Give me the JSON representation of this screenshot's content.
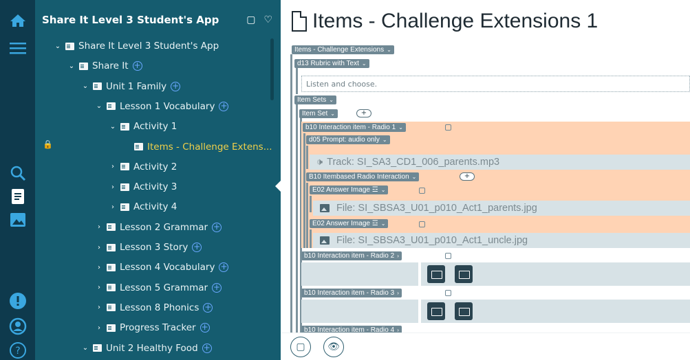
{
  "app": {
    "title": "Share It Level 3 Student's App",
    "header_icons": [
      "copy-icon",
      "heart-icon"
    ],
    "rail_icons": [
      "home-icon",
      "menu-icon",
      "search-icon",
      "document-icon",
      "image-icon",
      "alert-icon",
      "user-icon",
      "help-icon"
    ]
  },
  "tree": {
    "nodes": [
      {
        "label": "Share It Level 3 Student's App",
        "level": 1,
        "expanded": true,
        "add": false
      },
      {
        "label": "Share It",
        "level": 2,
        "expanded": true,
        "add": true
      },
      {
        "label": "Unit 1 Family",
        "level": 3,
        "expanded": true,
        "add": true
      },
      {
        "label": "Lesson 1 Vocabulary",
        "level": 4,
        "expanded": true,
        "add": true
      },
      {
        "label": "Activity 1",
        "level": 5,
        "expanded": true,
        "add": false
      },
      {
        "label": "Items - Challenge Extens...",
        "level": 6,
        "expanded": null,
        "add": false,
        "active": true
      },
      {
        "label": "Activity 2",
        "level": 5,
        "expanded": false,
        "add": false
      },
      {
        "label": "Activity 3",
        "level": 5,
        "expanded": false,
        "add": false
      },
      {
        "label": "Activity 4",
        "level": 5,
        "expanded": false,
        "add": false
      },
      {
        "label": "Lesson 2 Grammar",
        "level": 4,
        "expanded": false,
        "add": true
      },
      {
        "label": "Lesson 3 Story",
        "level": 4,
        "expanded": false,
        "add": true
      },
      {
        "label": "Lesson 4 Vocabulary",
        "level": 4,
        "expanded": false,
        "add": true
      },
      {
        "label": "Lesson 5 Grammar",
        "level": 4,
        "expanded": false,
        "add": true
      },
      {
        "label": "Lesson 8 Phonics",
        "level": 4,
        "expanded": false,
        "add": true
      },
      {
        "label": "Progress Tracker",
        "level": 4,
        "expanded": false,
        "add": true
      },
      {
        "label": "Unit 2 Healthy Food",
        "level": 3,
        "expanded": true,
        "add": true
      }
    ]
  },
  "content": {
    "title": "Items - Challenge Extensions 1",
    "tags": {
      "items": "Items - Challenge Extensions",
      "rubric": "d13 Rubric with Text",
      "item_sets": "Item Sets",
      "item_set": "Item Set",
      "radio1": "b10 Interaction item - Radio 1",
      "prompt": "d05 Prompt: audio only",
      "itembased": "B10 Itembased Radio Interaction",
      "answer_image_1": "E02 Answer Image ☲",
      "answer_image_2": "E02 Answer Image ☲",
      "radio2": "b10 Interaction item - Radio 2",
      "radio3": "b10 Interaction item - Radio 3",
      "radio4": "b10 Interaction item - Radio 4"
    },
    "rubric_text": "Listen and choose.",
    "track": "Track: SI_SA3_CD1_006_parents.mp3",
    "file1": "File: SI_SBSA3_U01_p010_Act1_parents.jpg",
    "file2": "File: SI_SBSA3_U01_p010_Act1_uncle.jpg"
  },
  "colors": {
    "rail": "#0e3a4d",
    "tree_bg": "#155c6f",
    "active": "#f0d04a",
    "tag": "#6f8894",
    "orange": "#ffd3b4",
    "grey": "#d7e2e6"
  }
}
